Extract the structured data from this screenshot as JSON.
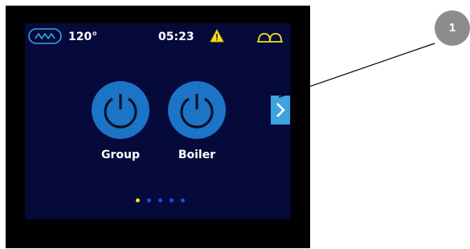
{
  "status": {
    "temperature": "120°",
    "time": "05:23",
    "icons": [
      "steam-wave-icon",
      "warning-icon",
      "cup-icon"
    ]
  },
  "buttons": [
    {
      "label": "Group",
      "icon": "power-icon"
    },
    {
      "label": "Boiler",
      "icon": "power-icon"
    }
  ],
  "navigation": {
    "next_icon": "chevron-right-icon"
  },
  "pager": {
    "total": 5,
    "active": 1
  },
  "callout": {
    "number": "1"
  },
  "colors": {
    "screen_bg": "#050a3a",
    "button_blue": "#1b74c6",
    "arrow_blue": "#3aa3e0",
    "warning_yellow": "#f4e21a",
    "dot_blue": "#1e4be0",
    "callout_gray": "#8c8c8c"
  }
}
